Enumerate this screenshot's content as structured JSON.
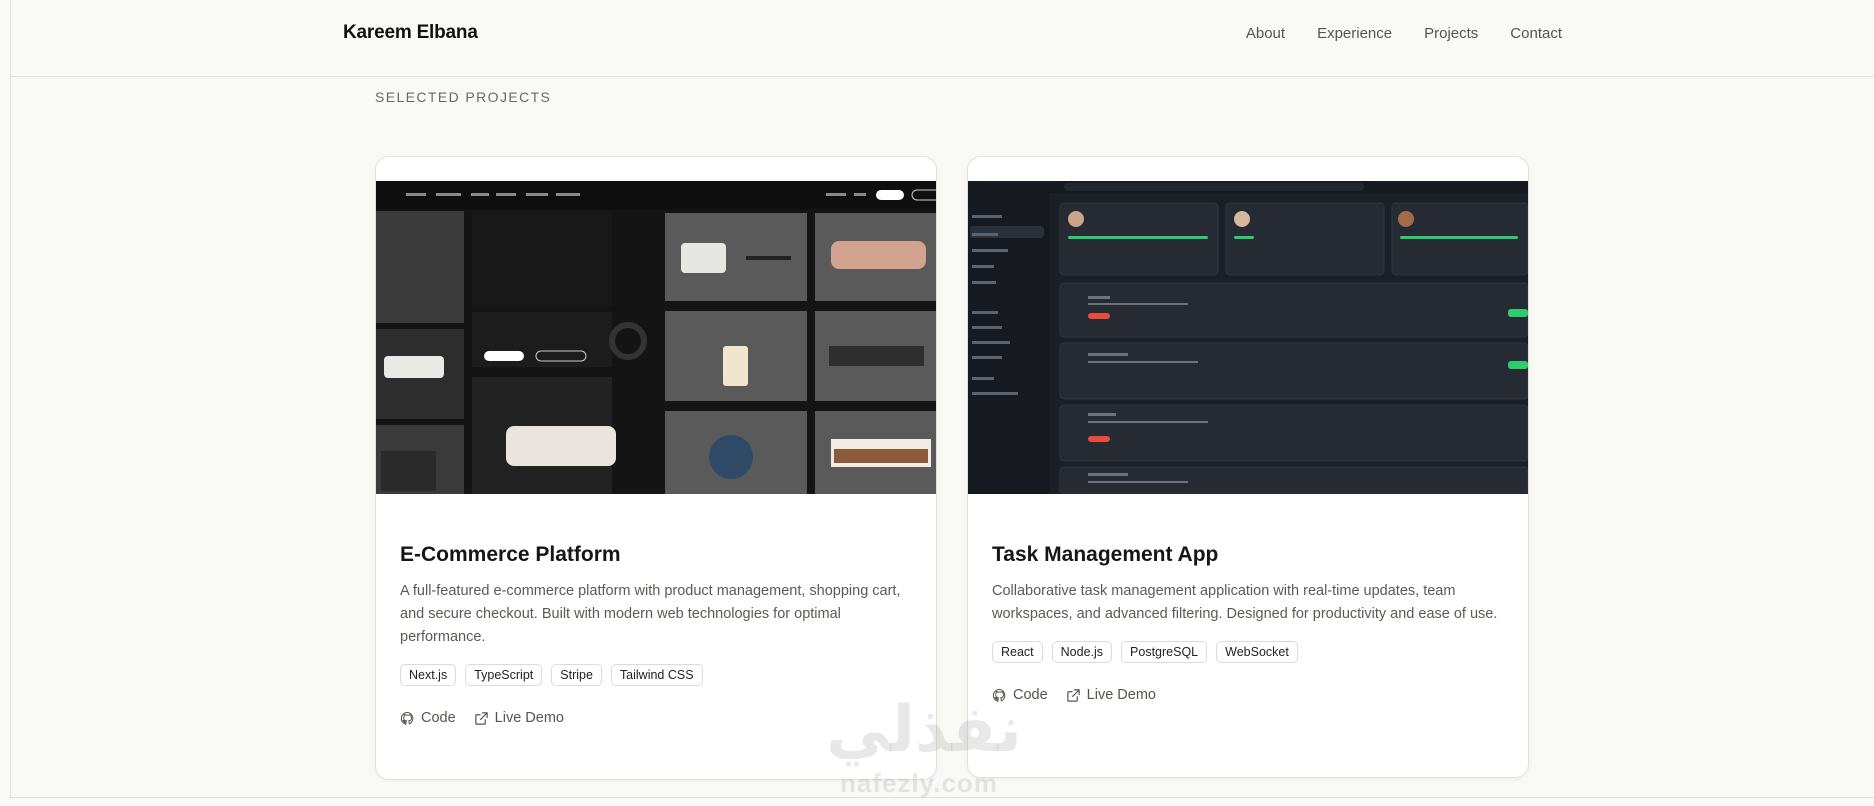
{
  "header": {
    "brand": "Kareem Elbana",
    "nav": [
      "About",
      "Experience",
      "Projects",
      "Contact"
    ]
  },
  "section": {
    "title": "SELECTED PROJECTS"
  },
  "projects": [
    {
      "title": "E-Commerce Platform",
      "description": "A full-featured e-commerce platform with product management, shopping cart, and secure checkout. Built with modern web technologies for optimal performance.",
      "tags": [
        "Next.js",
        "TypeScript",
        "Stripe",
        "Tailwind CSS"
      ],
      "links": {
        "code": "Code",
        "demo": "Live Demo"
      }
    },
    {
      "title": "Task Management App",
      "description": "Collaborative task management application with real-time updates, team workspaces, and advanced filtering. Designed for productivity and ease of use.",
      "tags": [
        "React",
        "Node.js",
        "PostgreSQL",
        "WebSocket"
      ],
      "links": {
        "code": "Code",
        "demo": "Live Demo"
      }
    }
  ],
  "watermark": {
    "arabic": "نفذلي",
    "latin": "nafezly.com"
  },
  "colors": {
    "background": "#f9f9f6",
    "accent_green": "#2ecc71",
    "badge_red": "#e74c3c"
  }
}
